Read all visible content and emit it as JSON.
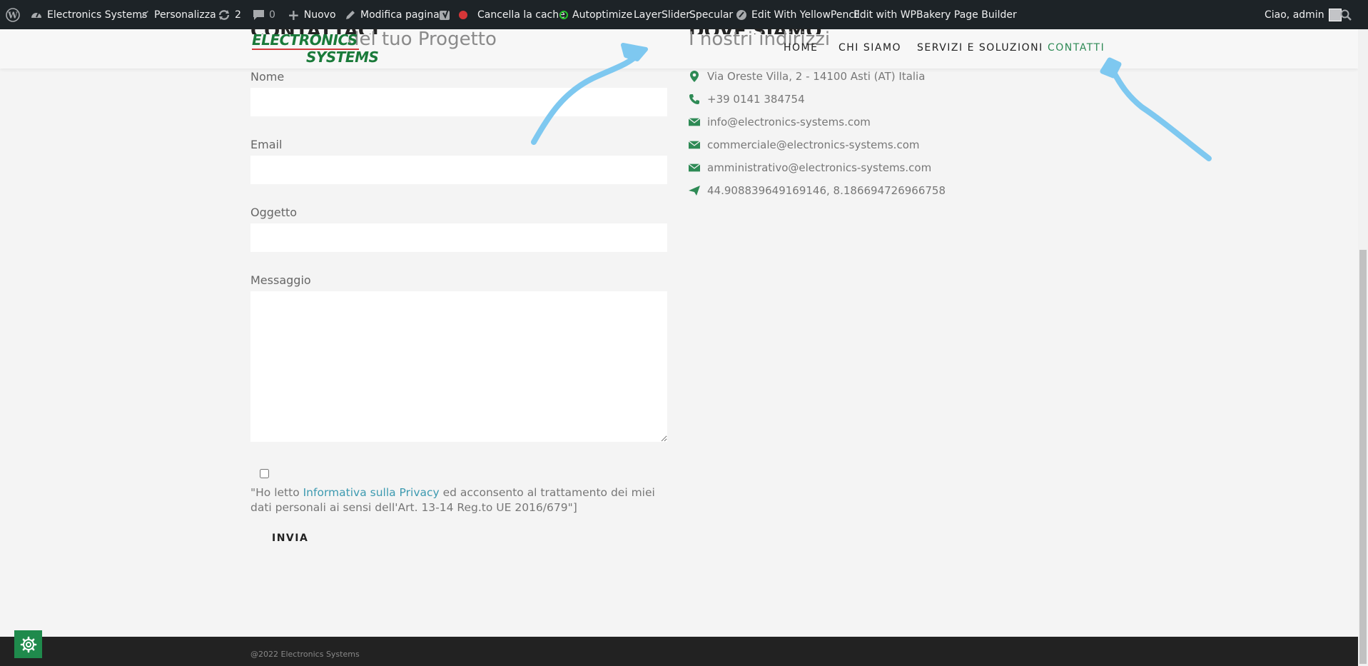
{
  "admin_bar": {
    "site_name": "Electronics Systems",
    "customize": "Personalizza",
    "updates_count": "2",
    "comments_count": "0",
    "new": "Nuovo",
    "edit_page": "Modifica pagina",
    "clear_cache": "Cancella la cache",
    "autoptimize": "Autoptimize",
    "layerslider": "LayerSlider",
    "specular": "Specular",
    "yellowpencil": "Edit With YellowPencil",
    "wpbakery": "Edit with WPBakery Page Builder",
    "greeting": "Ciao, admin"
  },
  "header": {
    "logo_line1": "ELECTRONICS",
    "logo_line2": "SYSTEMS",
    "nav": [
      "HOME",
      "CHI SIAMO",
      "SERVIZI E SOLUZIONI",
      "CONTATTI"
    ],
    "active_nav": "CONTATTI"
  },
  "contact_form": {
    "title_cut": "CONTATTACI",
    "subtitle": "del tuo Progetto",
    "name_label": "Nome",
    "email_label": "Email",
    "subject_label": "Oggetto",
    "message_label": "Messaggio",
    "consent_prefix": "\"Ho letto ",
    "consent_link": "Informativa sulla Privacy",
    "consent_suffix": " ed acconsento al trattamento dei miei dati personali ai sensi dell'Art. 13-14 Reg.to UE 2016/679\"]",
    "submit": "INVIA"
  },
  "addresses": {
    "title_cut": "DOVE SIAMO",
    "subtitle": "I nostri indirizzi",
    "items": [
      {
        "icon": "map-pin-icon",
        "text": "Via Oreste Villa, 2 - 14100 Asti (AT) Italia"
      },
      {
        "icon": "phone-icon",
        "text": "+39 0141 384754"
      },
      {
        "icon": "envelope-icon",
        "text": "info@electronics-systems.com"
      },
      {
        "icon": "envelope-icon",
        "text": "commerciale@electronics-systems.com"
      },
      {
        "icon": "envelope-icon",
        "text": "amministrativo@electronics-systems.com"
      },
      {
        "icon": "paper-plane-icon",
        "text": "44.908839649169146, 8.186694726966758"
      }
    ]
  },
  "footer": {
    "copyright": "@2022 Electronics Systems"
  },
  "colors": {
    "accent_green": "#2e8a55",
    "annotation_blue": "#7ec8f0",
    "admin_bar": "#1d2327"
  }
}
